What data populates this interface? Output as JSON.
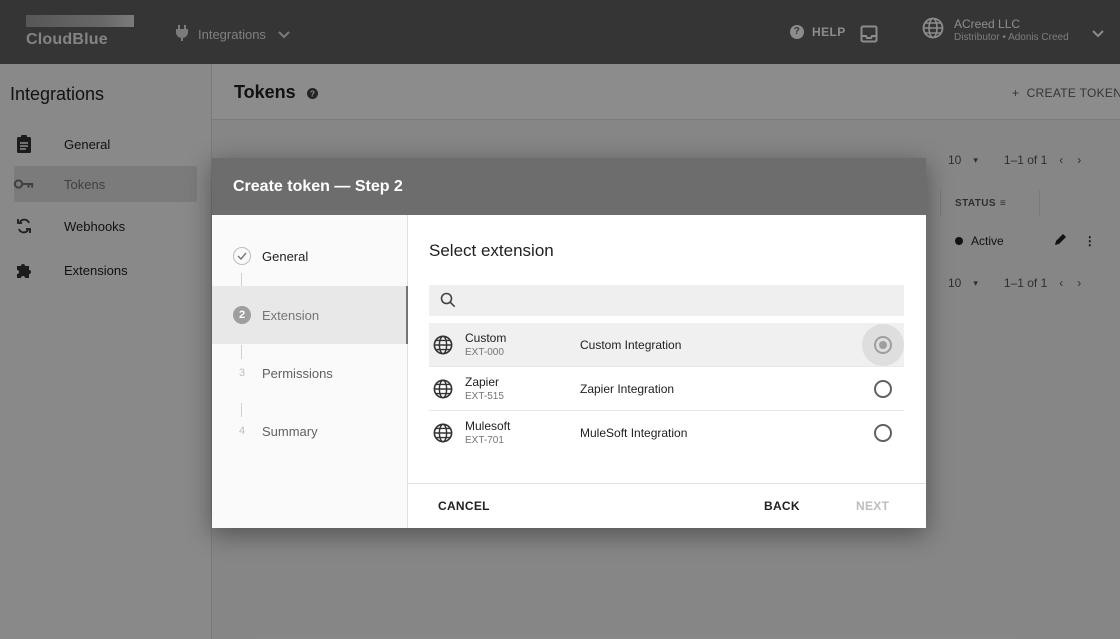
{
  "topbar": {
    "logo_text": "CloudBlue",
    "module_label": "Integrations",
    "help_label": "HELP",
    "account_name": "ACreed LLC",
    "account_sub": "Distributor • Adonis Creed"
  },
  "sidebar": {
    "title": "Integrations",
    "items": [
      {
        "label": "General",
        "icon": "clipboard-icon"
      },
      {
        "label": "Tokens",
        "icon": "key-icon"
      },
      {
        "label": "Webhooks",
        "icon": "sync-icon"
      },
      {
        "label": "Extensions",
        "icon": "puzzle-icon"
      }
    ]
  },
  "main": {
    "title": "Tokens",
    "create_label": "CREATE TOKEN",
    "rows_per_page": "10",
    "pagination": "1–1 of 1",
    "status_header": "STATUS",
    "status_value": "Active"
  },
  "dialog": {
    "title": "Create token — Step 2",
    "steps": [
      {
        "number": "✓",
        "label": "General",
        "state": "done"
      },
      {
        "number": "2",
        "label": "Extension",
        "state": "active"
      },
      {
        "number": "3",
        "label": "Permissions",
        "state": "future"
      },
      {
        "number": "4",
        "label": "Summary",
        "state": "future"
      }
    ],
    "select_title": "Select extension",
    "search_placeholder": "",
    "extensions": [
      {
        "name": "Custom",
        "id": "EXT-000",
        "description": "Custom Integration",
        "selected": true
      },
      {
        "name": "Zapier",
        "id": "EXT-515",
        "description": "Zapier Integration",
        "selected": false
      },
      {
        "name": "Mulesoft",
        "id": "EXT-701",
        "description": "MuleSoft Integration",
        "selected": false
      }
    ],
    "cancel_label": "CANCEL",
    "back_label": "BACK",
    "next_label": "NEXT"
  }
}
